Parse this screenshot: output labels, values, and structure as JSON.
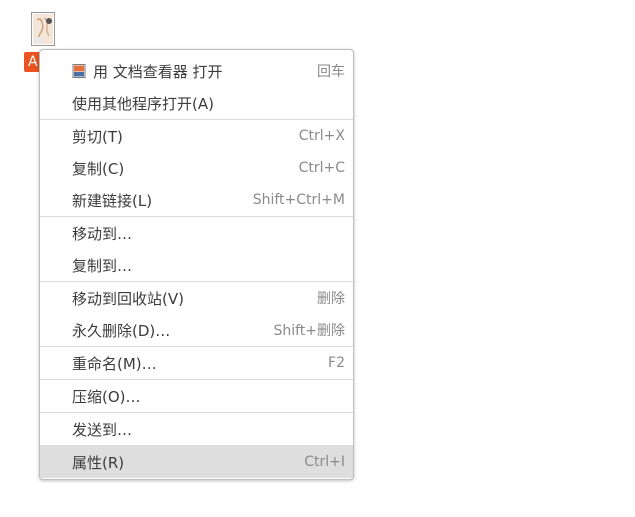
{
  "desktop": {
    "file_label": "A"
  },
  "menu": {
    "groups": [
      [
        {
          "label": "用 文档查看器 打开",
          "accel": "回车",
          "icon": "document-viewer-icon"
        },
        {
          "label": "使用其他程序打开(A)",
          "accel": ""
        }
      ],
      [
        {
          "label": "剪切(T)",
          "accel": "Ctrl+X"
        },
        {
          "label": "复制(C)",
          "accel": "Ctrl+C"
        },
        {
          "label": "新建链接(L)",
          "accel": "Shift+Ctrl+M"
        }
      ],
      [
        {
          "label": "移动到…",
          "accel": ""
        },
        {
          "label": "复制到…",
          "accel": ""
        }
      ],
      [
        {
          "label": "移动到回收站(V)",
          "accel": "删除"
        },
        {
          "label": "永久删除(D)…",
          "accel": "Shift+删除"
        }
      ],
      [
        {
          "label": "重命名(M)…",
          "accel": "F2"
        }
      ],
      [
        {
          "label": "压缩(O)…",
          "accel": ""
        }
      ],
      [
        {
          "label": "发送到…",
          "accel": ""
        }
      ],
      [
        {
          "label": "属性(R)",
          "accel": "Ctrl+I",
          "highlighted": true
        }
      ]
    ]
  },
  "colors": {
    "accent": "#e95420",
    "highlight": "#dedede"
  }
}
